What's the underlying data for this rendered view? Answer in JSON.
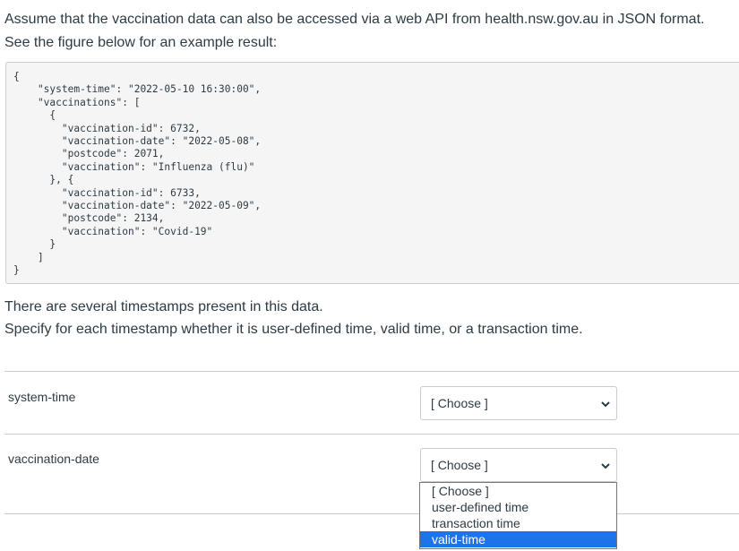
{
  "intro": {
    "line1": "Assume that the vaccination data can also be accessed via a web API from health.nsw.gov.au in JSON format.",
    "line2": "See the figure below for an example result:"
  },
  "code_sample": "{\n    \"system-time\": \"2022-05-10 16:30:00\",\n    \"vaccinations\": [\n      {\n        \"vaccination-id\": 6732,\n        \"vaccination-date\": \"2022-05-08\",\n        \"postcode\": 2071,\n        \"vaccination\": \"Influenza (flu)\"\n      }, {\n        \"vaccination-id\": 6733,\n        \"vaccination-date\": \"2022-05-09\",\n        \"postcode\": 2134,\n        \"vaccination\": \"Covid-19\"\n      }\n    ]\n}",
  "question": {
    "line1": "There are several timestamps present in this data.",
    "line2": "Specify for each timestamp whether it is user-defined time, valid time, or a transaction time."
  },
  "rows": [
    {
      "label": "system-time",
      "selected": "[ Choose ]"
    },
    {
      "label": "vaccination-date",
      "selected": "[ Choose ]"
    }
  ],
  "dropdown": {
    "options": [
      "[ Choose ]",
      "user-defined time",
      "transaction time",
      "valid-time"
    ],
    "highlighted": "valid-time"
  },
  "colors": {
    "highlight": "#1e73e8",
    "text": "#2d3b45",
    "border": "#c7cdd1",
    "code_bg": "#f5f5f5"
  },
  "icons": {
    "select_arrow": "chevron-down-icon"
  }
}
